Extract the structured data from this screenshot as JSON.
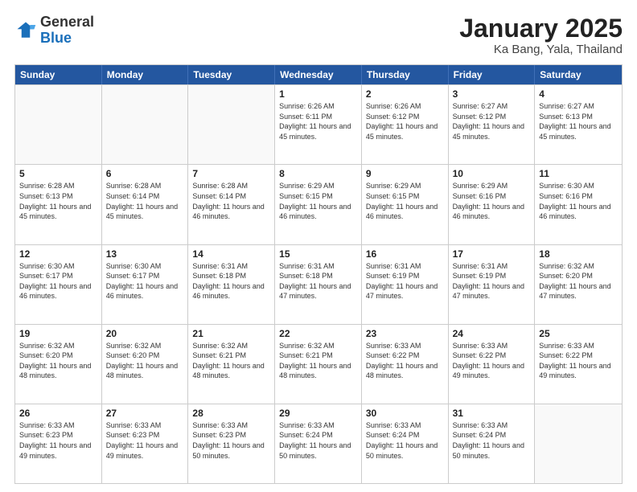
{
  "header": {
    "logo_general": "General",
    "logo_blue": "Blue",
    "title": "January 2025",
    "subtitle": "Ka Bang, Yala, Thailand"
  },
  "calendar": {
    "days_of_week": [
      "Sunday",
      "Monday",
      "Tuesday",
      "Wednesday",
      "Thursday",
      "Friday",
      "Saturday"
    ],
    "rows": [
      [
        {
          "day": "",
          "info": "",
          "empty": true
        },
        {
          "day": "",
          "info": "",
          "empty": true
        },
        {
          "day": "",
          "info": "",
          "empty": true
        },
        {
          "day": "1",
          "info": "Sunrise: 6:26 AM\nSunset: 6:11 PM\nDaylight: 11 hours and 45 minutes.",
          "empty": false
        },
        {
          "day": "2",
          "info": "Sunrise: 6:26 AM\nSunset: 6:12 PM\nDaylight: 11 hours and 45 minutes.",
          "empty": false
        },
        {
          "day": "3",
          "info": "Sunrise: 6:27 AM\nSunset: 6:12 PM\nDaylight: 11 hours and 45 minutes.",
          "empty": false
        },
        {
          "day": "4",
          "info": "Sunrise: 6:27 AM\nSunset: 6:13 PM\nDaylight: 11 hours and 45 minutes.",
          "empty": false
        }
      ],
      [
        {
          "day": "5",
          "info": "Sunrise: 6:28 AM\nSunset: 6:13 PM\nDaylight: 11 hours and 45 minutes.",
          "empty": false
        },
        {
          "day": "6",
          "info": "Sunrise: 6:28 AM\nSunset: 6:14 PM\nDaylight: 11 hours and 45 minutes.",
          "empty": false
        },
        {
          "day": "7",
          "info": "Sunrise: 6:28 AM\nSunset: 6:14 PM\nDaylight: 11 hours and 46 minutes.",
          "empty": false
        },
        {
          "day": "8",
          "info": "Sunrise: 6:29 AM\nSunset: 6:15 PM\nDaylight: 11 hours and 46 minutes.",
          "empty": false
        },
        {
          "day": "9",
          "info": "Sunrise: 6:29 AM\nSunset: 6:15 PM\nDaylight: 11 hours and 46 minutes.",
          "empty": false
        },
        {
          "day": "10",
          "info": "Sunrise: 6:29 AM\nSunset: 6:16 PM\nDaylight: 11 hours and 46 minutes.",
          "empty": false
        },
        {
          "day": "11",
          "info": "Sunrise: 6:30 AM\nSunset: 6:16 PM\nDaylight: 11 hours and 46 minutes.",
          "empty": false
        }
      ],
      [
        {
          "day": "12",
          "info": "Sunrise: 6:30 AM\nSunset: 6:17 PM\nDaylight: 11 hours and 46 minutes.",
          "empty": false
        },
        {
          "day": "13",
          "info": "Sunrise: 6:30 AM\nSunset: 6:17 PM\nDaylight: 11 hours and 46 minutes.",
          "empty": false
        },
        {
          "day": "14",
          "info": "Sunrise: 6:31 AM\nSunset: 6:18 PM\nDaylight: 11 hours and 46 minutes.",
          "empty": false
        },
        {
          "day": "15",
          "info": "Sunrise: 6:31 AM\nSunset: 6:18 PM\nDaylight: 11 hours and 47 minutes.",
          "empty": false
        },
        {
          "day": "16",
          "info": "Sunrise: 6:31 AM\nSunset: 6:19 PM\nDaylight: 11 hours and 47 minutes.",
          "empty": false
        },
        {
          "day": "17",
          "info": "Sunrise: 6:31 AM\nSunset: 6:19 PM\nDaylight: 11 hours and 47 minutes.",
          "empty": false
        },
        {
          "day": "18",
          "info": "Sunrise: 6:32 AM\nSunset: 6:20 PM\nDaylight: 11 hours and 47 minutes.",
          "empty": false
        }
      ],
      [
        {
          "day": "19",
          "info": "Sunrise: 6:32 AM\nSunset: 6:20 PM\nDaylight: 11 hours and 48 minutes.",
          "empty": false
        },
        {
          "day": "20",
          "info": "Sunrise: 6:32 AM\nSunset: 6:20 PM\nDaylight: 11 hours and 48 minutes.",
          "empty": false
        },
        {
          "day": "21",
          "info": "Sunrise: 6:32 AM\nSunset: 6:21 PM\nDaylight: 11 hours and 48 minutes.",
          "empty": false
        },
        {
          "day": "22",
          "info": "Sunrise: 6:32 AM\nSunset: 6:21 PM\nDaylight: 11 hours and 48 minutes.",
          "empty": false
        },
        {
          "day": "23",
          "info": "Sunrise: 6:33 AM\nSunset: 6:22 PM\nDaylight: 11 hours and 48 minutes.",
          "empty": false
        },
        {
          "day": "24",
          "info": "Sunrise: 6:33 AM\nSunset: 6:22 PM\nDaylight: 11 hours and 49 minutes.",
          "empty": false
        },
        {
          "day": "25",
          "info": "Sunrise: 6:33 AM\nSunset: 6:22 PM\nDaylight: 11 hours and 49 minutes.",
          "empty": false
        }
      ],
      [
        {
          "day": "26",
          "info": "Sunrise: 6:33 AM\nSunset: 6:23 PM\nDaylight: 11 hours and 49 minutes.",
          "empty": false
        },
        {
          "day": "27",
          "info": "Sunrise: 6:33 AM\nSunset: 6:23 PM\nDaylight: 11 hours and 49 minutes.",
          "empty": false
        },
        {
          "day": "28",
          "info": "Sunrise: 6:33 AM\nSunset: 6:23 PM\nDaylight: 11 hours and 50 minutes.",
          "empty": false
        },
        {
          "day": "29",
          "info": "Sunrise: 6:33 AM\nSunset: 6:24 PM\nDaylight: 11 hours and 50 minutes.",
          "empty": false
        },
        {
          "day": "30",
          "info": "Sunrise: 6:33 AM\nSunset: 6:24 PM\nDaylight: 11 hours and 50 minutes.",
          "empty": false
        },
        {
          "day": "31",
          "info": "Sunrise: 6:33 AM\nSunset: 6:24 PM\nDaylight: 11 hours and 50 minutes.",
          "empty": false
        },
        {
          "day": "",
          "info": "",
          "empty": true
        }
      ]
    ]
  }
}
